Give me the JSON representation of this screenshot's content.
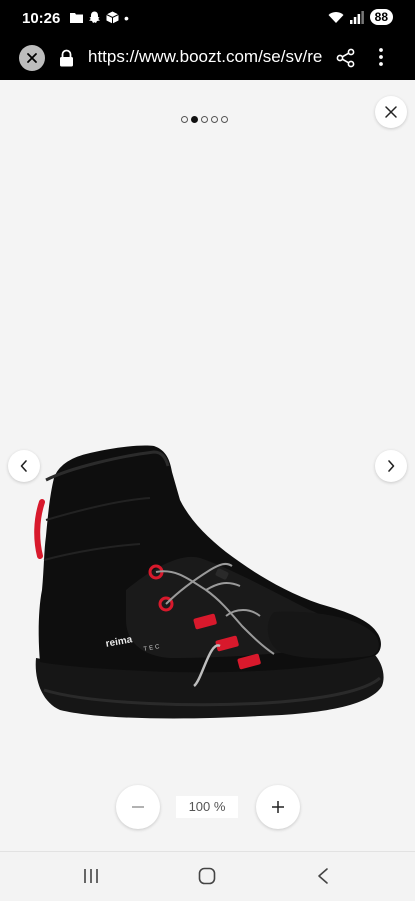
{
  "status_bar": {
    "time": "10:26",
    "battery": "88",
    "dot": "•"
  },
  "browser": {
    "url": "https://www.boozt.com/se/sv/re"
  },
  "gallery": {
    "image_count": 5,
    "active_index": 1,
    "image_alt": "Reima Tec black winter boot with red lace loops",
    "brand_on_shoe": "reima",
    "tech_on_shoe": "TEC"
  },
  "zoom": {
    "level": "100 %"
  },
  "icons": {
    "close": "close-icon",
    "prev": "chevron-left-icon",
    "next": "chevron-right-icon",
    "zoom_out": "minus-icon",
    "zoom_in": "plus-icon"
  },
  "colors": {
    "viewer_bg": "#f4f4f4",
    "boot_black": "#111111",
    "lace_red": "#d8192c"
  }
}
